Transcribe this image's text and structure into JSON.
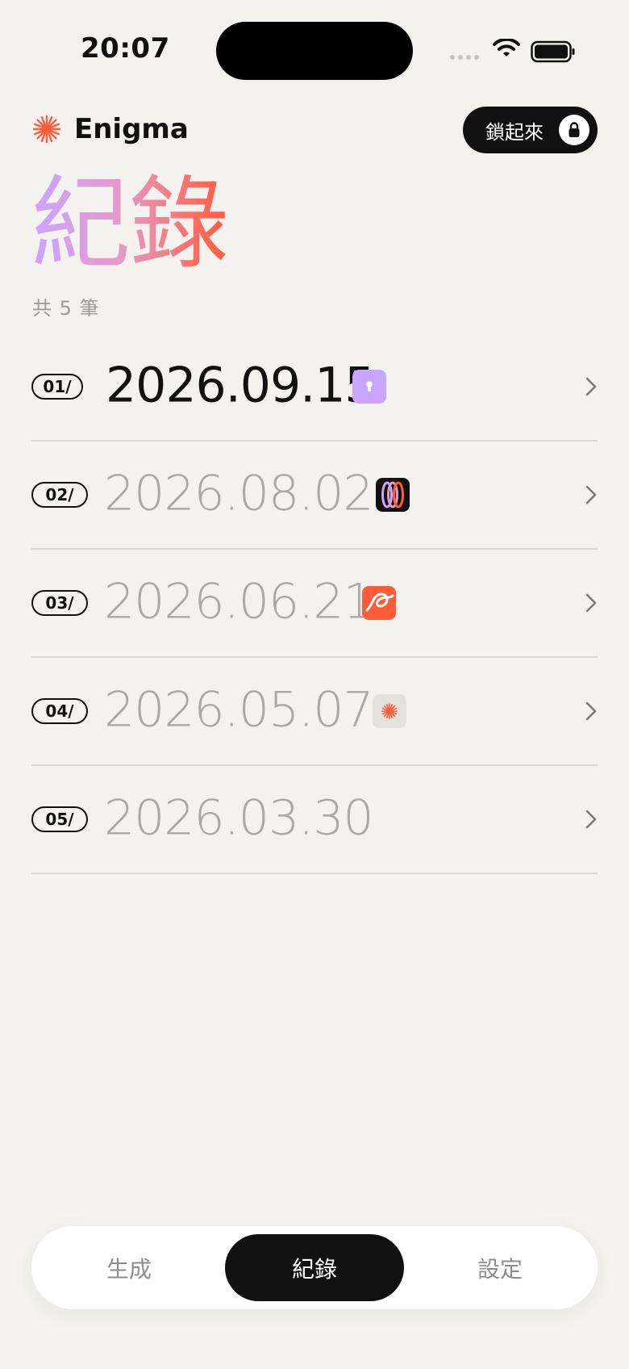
{
  "status_bar": {
    "time": "20:07"
  },
  "header": {
    "app_name": "Enigma",
    "lock_button_label": "鎖起來"
  },
  "page": {
    "title": "紀錄",
    "count_label": "共 5 筆"
  },
  "records": [
    {
      "index": "01/",
      "date": "2026.09.15",
      "icon": "lock-keyhole-icon",
      "active": true
    },
    {
      "index": "02/",
      "date": "2026.08.02",
      "icon": "rings-icon",
      "active": false
    },
    {
      "index": "03/",
      "date": "2026.06.21",
      "icon": "swirl-icon",
      "active": false
    },
    {
      "index": "04/",
      "date": "2026.05.07",
      "icon": "sunburst-icon",
      "active": false
    },
    {
      "index": "05/",
      "date": "2026.03.30",
      "icon": "",
      "active": false
    }
  ],
  "tabs": [
    {
      "label": "生成",
      "active": false
    },
    {
      "label": "紀錄",
      "active": true
    },
    {
      "label": "設定",
      "active": false
    }
  ],
  "colors": {
    "background": "#F3F2EF",
    "accent": "#FF5C3A",
    "lavender": "#C8A6FF",
    "dark": "#111111",
    "muted_text": "#A9A8A6"
  }
}
